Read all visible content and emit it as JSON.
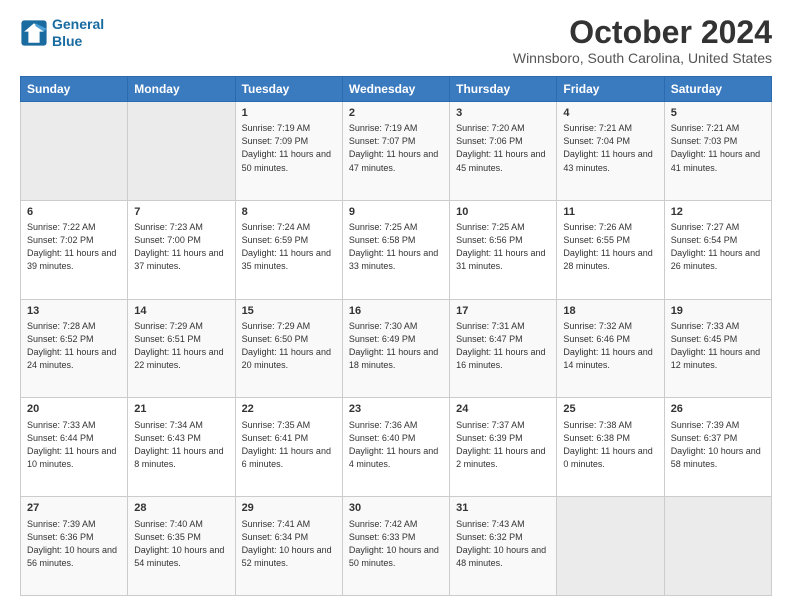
{
  "logo": {
    "line1": "General",
    "line2": "Blue"
  },
  "title": "October 2024",
  "subtitle": "Winnsboro, South Carolina, United States",
  "days_header": [
    "Sunday",
    "Monday",
    "Tuesday",
    "Wednesday",
    "Thursday",
    "Friday",
    "Saturday"
  ],
  "weeks": [
    [
      {
        "day": "",
        "info": ""
      },
      {
        "day": "",
        "info": ""
      },
      {
        "day": "1",
        "info": "Sunrise: 7:19 AM\nSunset: 7:09 PM\nDaylight: 11 hours and 50 minutes."
      },
      {
        "day": "2",
        "info": "Sunrise: 7:19 AM\nSunset: 7:07 PM\nDaylight: 11 hours and 47 minutes."
      },
      {
        "day": "3",
        "info": "Sunrise: 7:20 AM\nSunset: 7:06 PM\nDaylight: 11 hours and 45 minutes."
      },
      {
        "day": "4",
        "info": "Sunrise: 7:21 AM\nSunset: 7:04 PM\nDaylight: 11 hours and 43 minutes."
      },
      {
        "day": "5",
        "info": "Sunrise: 7:21 AM\nSunset: 7:03 PM\nDaylight: 11 hours and 41 minutes."
      }
    ],
    [
      {
        "day": "6",
        "info": "Sunrise: 7:22 AM\nSunset: 7:02 PM\nDaylight: 11 hours and 39 minutes."
      },
      {
        "day": "7",
        "info": "Sunrise: 7:23 AM\nSunset: 7:00 PM\nDaylight: 11 hours and 37 minutes."
      },
      {
        "day": "8",
        "info": "Sunrise: 7:24 AM\nSunset: 6:59 PM\nDaylight: 11 hours and 35 minutes."
      },
      {
        "day": "9",
        "info": "Sunrise: 7:25 AM\nSunset: 6:58 PM\nDaylight: 11 hours and 33 minutes."
      },
      {
        "day": "10",
        "info": "Sunrise: 7:25 AM\nSunset: 6:56 PM\nDaylight: 11 hours and 31 minutes."
      },
      {
        "day": "11",
        "info": "Sunrise: 7:26 AM\nSunset: 6:55 PM\nDaylight: 11 hours and 28 minutes."
      },
      {
        "day": "12",
        "info": "Sunrise: 7:27 AM\nSunset: 6:54 PM\nDaylight: 11 hours and 26 minutes."
      }
    ],
    [
      {
        "day": "13",
        "info": "Sunrise: 7:28 AM\nSunset: 6:52 PM\nDaylight: 11 hours and 24 minutes."
      },
      {
        "day": "14",
        "info": "Sunrise: 7:29 AM\nSunset: 6:51 PM\nDaylight: 11 hours and 22 minutes."
      },
      {
        "day": "15",
        "info": "Sunrise: 7:29 AM\nSunset: 6:50 PM\nDaylight: 11 hours and 20 minutes."
      },
      {
        "day": "16",
        "info": "Sunrise: 7:30 AM\nSunset: 6:49 PM\nDaylight: 11 hours and 18 minutes."
      },
      {
        "day": "17",
        "info": "Sunrise: 7:31 AM\nSunset: 6:47 PM\nDaylight: 11 hours and 16 minutes."
      },
      {
        "day": "18",
        "info": "Sunrise: 7:32 AM\nSunset: 6:46 PM\nDaylight: 11 hours and 14 minutes."
      },
      {
        "day": "19",
        "info": "Sunrise: 7:33 AM\nSunset: 6:45 PM\nDaylight: 11 hours and 12 minutes."
      }
    ],
    [
      {
        "day": "20",
        "info": "Sunrise: 7:33 AM\nSunset: 6:44 PM\nDaylight: 11 hours and 10 minutes."
      },
      {
        "day": "21",
        "info": "Sunrise: 7:34 AM\nSunset: 6:43 PM\nDaylight: 11 hours and 8 minutes."
      },
      {
        "day": "22",
        "info": "Sunrise: 7:35 AM\nSunset: 6:41 PM\nDaylight: 11 hours and 6 minutes."
      },
      {
        "day": "23",
        "info": "Sunrise: 7:36 AM\nSunset: 6:40 PM\nDaylight: 11 hours and 4 minutes."
      },
      {
        "day": "24",
        "info": "Sunrise: 7:37 AM\nSunset: 6:39 PM\nDaylight: 11 hours and 2 minutes."
      },
      {
        "day": "25",
        "info": "Sunrise: 7:38 AM\nSunset: 6:38 PM\nDaylight: 11 hours and 0 minutes."
      },
      {
        "day": "26",
        "info": "Sunrise: 7:39 AM\nSunset: 6:37 PM\nDaylight: 10 hours and 58 minutes."
      }
    ],
    [
      {
        "day": "27",
        "info": "Sunrise: 7:39 AM\nSunset: 6:36 PM\nDaylight: 10 hours and 56 minutes."
      },
      {
        "day": "28",
        "info": "Sunrise: 7:40 AM\nSunset: 6:35 PM\nDaylight: 10 hours and 54 minutes."
      },
      {
        "day": "29",
        "info": "Sunrise: 7:41 AM\nSunset: 6:34 PM\nDaylight: 10 hours and 52 minutes."
      },
      {
        "day": "30",
        "info": "Sunrise: 7:42 AM\nSunset: 6:33 PM\nDaylight: 10 hours and 50 minutes."
      },
      {
        "day": "31",
        "info": "Sunrise: 7:43 AM\nSunset: 6:32 PM\nDaylight: 10 hours and 48 minutes."
      },
      {
        "day": "",
        "info": ""
      },
      {
        "day": "",
        "info": ""
      }
    ]
  ]
}
